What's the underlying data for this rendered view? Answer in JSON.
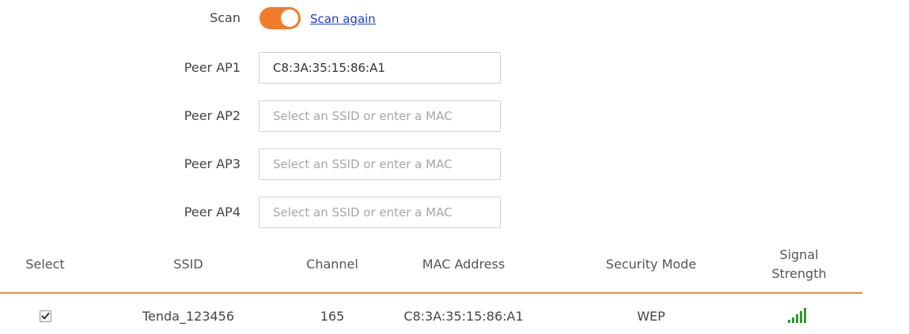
{
  "scan": {
    "label": "Scan",
    "toggle_on": true,
    "toggle_color": "#f07c2c",
    "rescan_link": "Scan again"
  },
  "peers": [
    {
      "label": "Peer AP1",
      "value": "C8:3A:35:15:86:A1",
      "placeholder": "Select an SSID or enter a MAC"
    },
    {
      "label": "Peer AP2",
      "value": "",
      "placeholder": "Select an SSID or enter a MAC"
    },
    {
      "label": "Peer AP3",
      "value": "",
      "placeholder": "Select an SSID or enter a MAC"
    },
    {
      "label": "Peer AP4",
      "value": "",
      "placeholder": "Select an SSID or enter a MAC"
    }
  ],
  "table": {
    "accent_color": "#f08a3a",
    "headers": {
      "select": "Select",
      "ssid": "SSID",
      "channel": "Channel",
      "mac": "MAC Address",
      "security": "Security Mode",
      "signal_line1": "Signal",
      "signal_line2": "Strength"
    },
    "rows": [
      {
        "selected": true,
        "ssid": "Tenda_123456",
        "channel": "165",
        "mac": "C8:3A:35:15:86:A1",
        "security": "WEP",
        "signal_icon": "signal-strength-icon",
        "signal_bars": 5,
        "signal_color": "#2e9a2e"
      }
    ]
  }
}
